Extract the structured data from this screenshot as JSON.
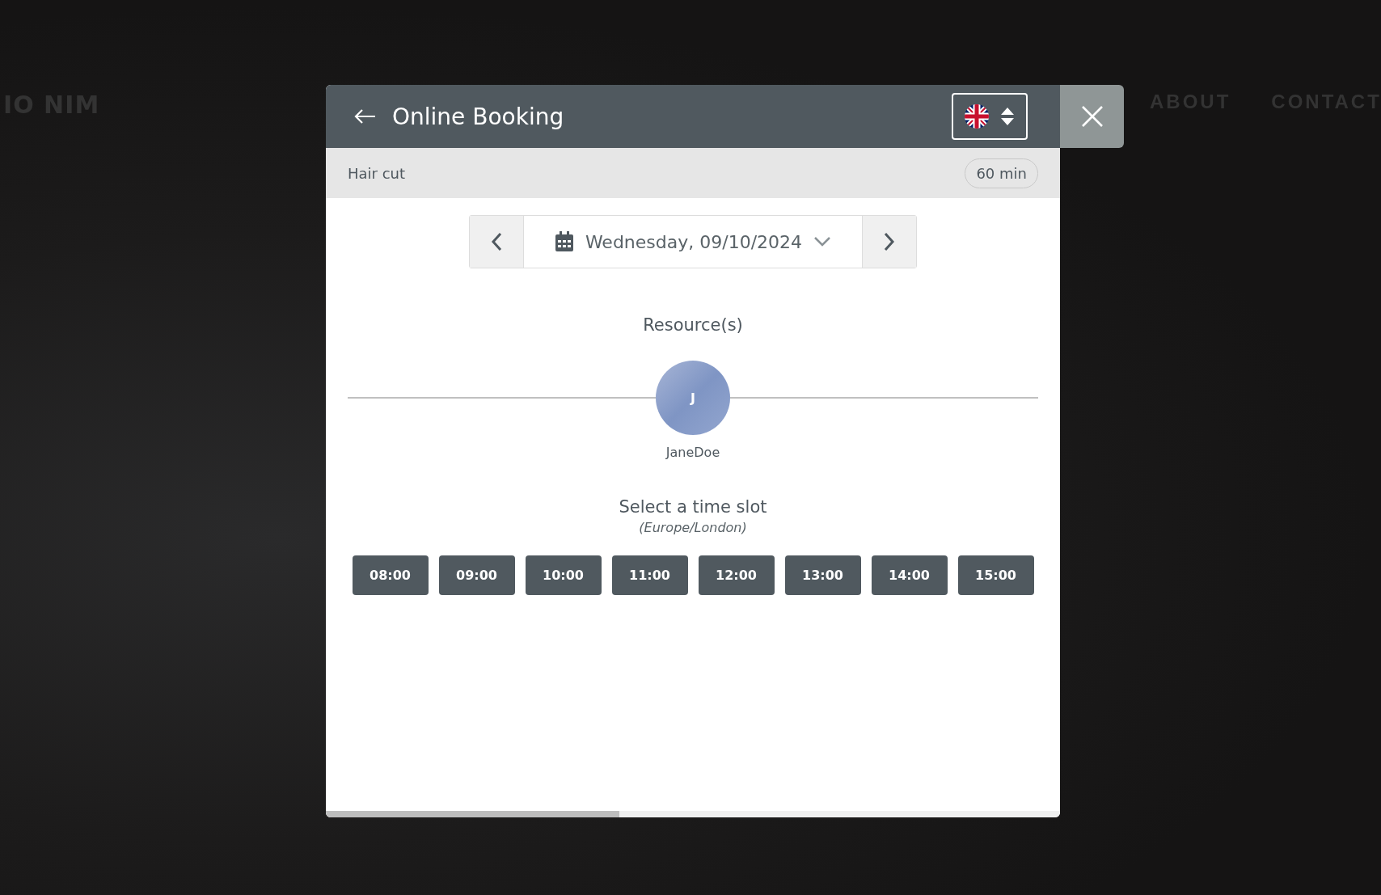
{
  "background": {
    "logo": "IO NIM",
    "nav": [
      "ABOUT",
      "CONTACT"
    ]
  },
  "dialog": {
    "title": "Online Booking",
    "service": "Hair cut",
    "duration": "60 min",
    "date": "Wednesday, 09/10/2024",
    "resources_title": "Resource(s)",
    "resources": [
      {
        "initial": "J",
        "name": "JaneDoe"
      }
    ],
    "slots_title": "Select a time slot",
    "timezone": "(Europe/London)",
    "slots": [
      "08:00",
      "09:00",
      "10:00",
      "11:00",
      "12:00",
      "13:00",
      "14:00",
      "15:00"
    ]
  }
}
